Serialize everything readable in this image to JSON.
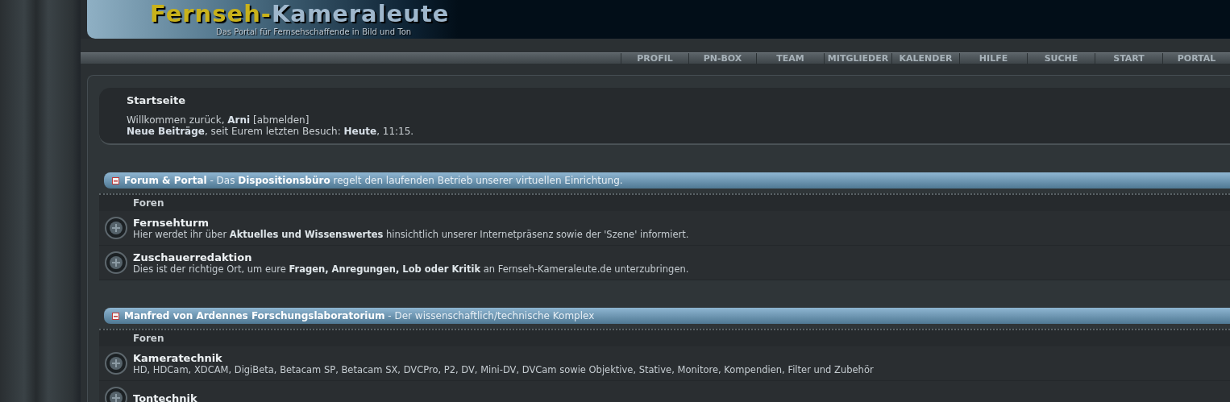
{
  "logo": {
    "title_part1": "Fernseh-",
    "title_part2": "Kameraleute",
    "tagline": "Das Portal für Fernsehschaffende in Bild und Ton"
  },
  "nav": [
    "PROFIL",
    "PN-BOX",
    "TEAM",
    "MITGLIEDER",
    "KALENDER",
    "HILFE",
    "SUCHE",
    "START",
    "PORTAL"
  ],
  "welcome": {
    "title": "Startseite",
    "line1": "Willkommen zurück, **Arni**",
    "logout": "[abmelden]",
    "line2": "**Neue Beiträge**, seit Eurem letzten Besuch: **Heute**, 11:15."
  },
  "categories": [
    {
      "title": "**Forum & Portal** - Das **Dispositionsbüro** regelt den laufenden Betrieb unserer virtuellen Einrichtung.",
      "header": "Foren",
      "forums": [
        {
          "name": "Fernsehturm",
          "description": "Hier werdet ihr über **Aktuelles und Wissenswertes** hinsichtlich unserer Internetpräsenz sowie der 'Szene' informiert."
        },
        {
          "name": "Zuschauerredaktion",
          "description": "Dies ist der richtige Ort, um eure **Fragen, Anregungen, Lob oder Kritik** an Fernseh-Kameraleute.de unterzubringen."
        }
      ]
    },
    {
      "title": "**Manfred von Ardennes Forschungslaboratorium** - Der wissenschaftlich/technische Komplex",
      "header": "Foren",
      "forums": [
        {
          "name": "Kameratechnik",
          "description": "HD, HDCam, XDCAM, DigiBeta, Betacam SP, Betacam SX, DVCPro, P2, DV, Mini-DV, DVCam sowie Objektive, Stative, Monitore, Kompendien, Filter und Zubehör"
        },
        {
          "name": "Tontechnik"
        }
      ]
    }
  ]
}
